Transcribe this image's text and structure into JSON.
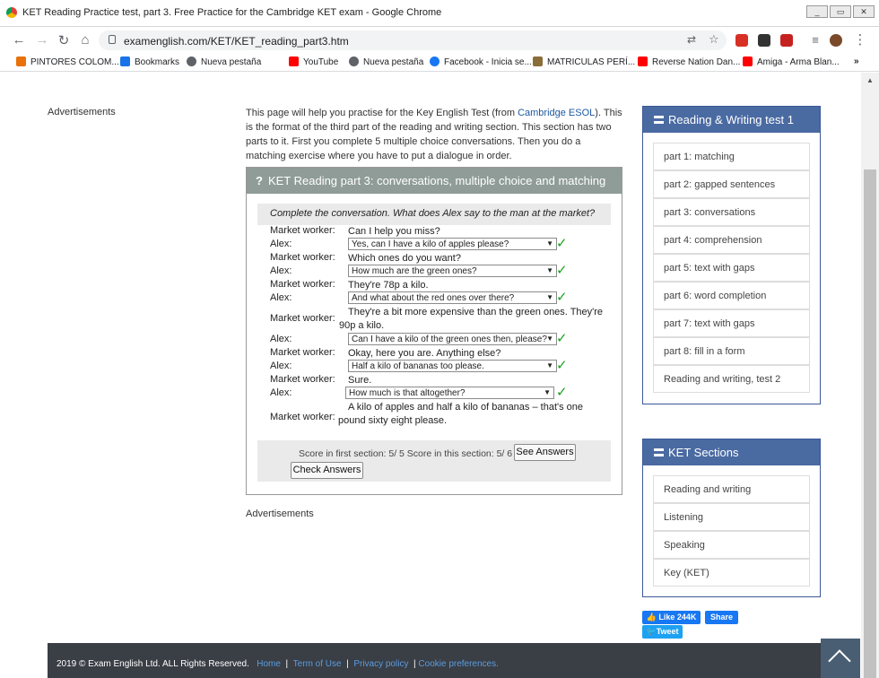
{
  "window": {
    "title": "KET Reading Practice test, part 3. Free Practice for the Cambridge KET exam - Google Chrome",
    "url": "examenglish.com/KET/KET_reading_part3.htm"
  },
  "bookmarks": [
    {
      "label": "PINTORES COLOM...",
      "color": "#e8710a"
    },
    {
      "label": "Bookmarks",
      "color": "#1a73e8"
    },
    {
      "label": "Nueva pestaña",
      "color": "#5f6368"
    },
    {
      "label": "YouTube",
      "color": "#ff0000"
    },
    {
      "label": "Nueva pestaña",
      "color": "#5f6368"
    },
    {
      "label": "Facebook - Inicia se...",
      "color": "#1877f2"
    },
    {
      "label": "MATRICULAS PERÍ...",
      "color": "#8b6d3a"
    },
    {
      "label": "Reverse Nation Dan...",
      "color": "#ff0000"
    },
    {
      "label": "Amiga - Arma Blan...",
      "color": "#ff0000"
    }
  ],
  "page": {
    "advertisements": "Advertisements",
    "intro": {
      "before_link": "This page will help you practise for the Key English Test (from ",
      "link": "Cambridge ESOL",
      "after_link": "). This is the format of the third part of the reading and writing section. This section has two parts to it. First you complete 5 multiple choice conversations. Then you do a matching exercise where you have to put a dialogue in order."
    },
    "panel_title": "KET Reading part 3: conversations, multiple choice and matching",
    "instruction": "Complete the conversation. What does Alex say to the man at the market?",
    "dialogue": [
      {
        "speaker": "Market worker:",
        "text": "Can I help you miss?"
      },
      {
        "speaker": "Alex:",
        "select": "Yes, can I have a kilo of apples please?",
        "correct": true
      },
      {
        "speaker": "Market worker:",
        "text": "Which ones do you want?"
      },
      {
        "speaker": "Alex:",
        "select": "How much are the green ones?",
        "correct": true
      },
      {
        "speaker": "Market worker:",
        "text": "They're 78p a kilo."
      },
      {
        "speaker": "Alex:",
        "select": "And what about the red ones over there?",
        "correct": true
      },
      {
        "speaker": "Market worker:",
        "text": "They're a bit more expensive than the green ones. They're 90p a kilo."
      },
      {
        "speaker": "Alex:",
        "select": "Can I have a kilo of the green ones then, please?",
        "correct": true
      },
      {
        "speaker": "Market worker:",
        "text": "Okay, here you are. Anything else?"
      },
      {
        "speaker": "Alex:",
        "select": "Half a kilo of bananas too please.",
        "correct": true
      },
      {
        "speaker": "Market worker:",
        "text": "Sure."
      },
      {
        "speaker": "Alex:",
        "select": "How much is that altogether?",
        "correct": true
      },
      {
        "speaker": "Market worker:",
        "text": "A kilo of apples and half a kilo of bananas – that's one pound sixty eight please."
      }
    ],
    "score_text": "Score in first section: 5/ 5   Score in this section: 5/ 6",
    "see_answers": "See Answers",
    "check_answers": "Check Answers"
  },
  "sidebar": {
    "rw_title": "Reading & Writing test 1",
    "rw_items": [
      "part 1: matching",
      "part 2: gapped sentences",
      "part 3: conversations",
      "part 4: comprehension",
      "part 5: text with gaps",
      "part 6: word completion",
      "part 7: text with gaps",
      "part 8: fill in a form",
      "Reading and writing, test 2"
    ],
    "ket_title": "KET Sections",
    "ket_items": [
      "Reading and writing",
      "Listening",
      "Speaking",
      "Key (KET)"
    ],
    "like": "Like 244K",
    "share": "Share",
    "tweet": "Tweet"
  },
  "footer": {
    "copyright": "2019 © Exam English Ltd. ALL Rights Reserved.",
    "links": [
      "Home",
      "Term of Use",
      "Privacy policy",
      "Cookie preferences."
    ]
  }
}
